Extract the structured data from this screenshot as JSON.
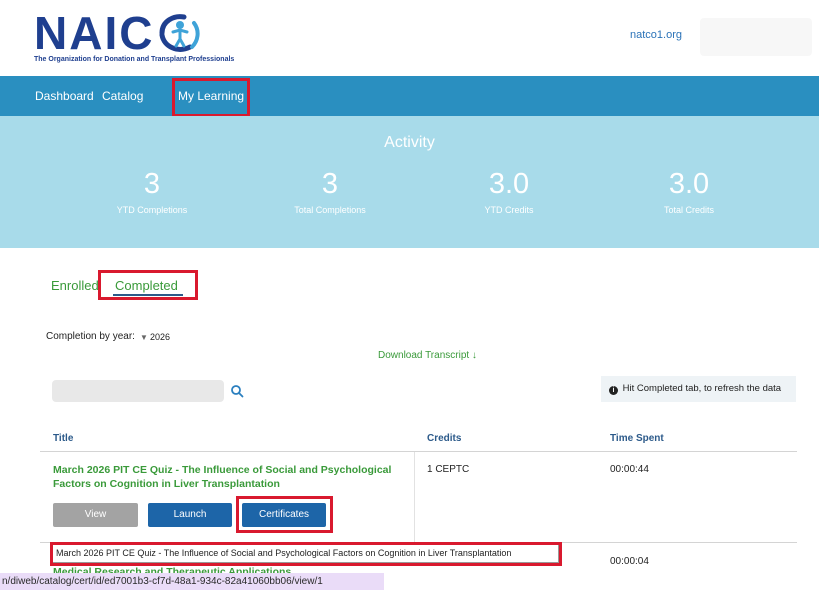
{
  "header": {
    "logo_text": "NAIC",
    "logo_tagline": "The Organization for Donation and Transplant Professionals",
    "site_link": "natco1.org"
  },
  "nav": {
    "items": [
      {
        "label": "Dashboard"
      },
      {
        "label": "Catalog"
      },
      {
        "label": "My Learning"
      }
    ]
  },
  "activity": {
    "title": "Activity",
    "stats": [
      {
        "value": "3",
        "label": "YTD Completions"
      },
      {
        "value": "3",
        "label": "Total Completions"
      },
      {
        "value": "3.0",
        "label": "YTD Credits"
      },
      {
        "value": "3.0",
        "label": "Total Credits"
      }
    ]
  },
  "tabs": {
    "enrolled": "Enrolled",
    "completed": "Completed"
  },
  "filters": {
    "year_label": "Completion by year:",
    "year_value": "2026",
    "download_label": "Download Transcript ↓",
    "search_placeholder": "",
    "hint": "Hit Completed tab, to refresh the data"
  },
  "table": {
    "headers": [
      "Title",
      "Credits",
      "Time Spent"
    ],
    "rows": [
      {
        "title": "March 2026 PIT CE Quiz - The Influence of Social and Psychological Factors on Cognition in Liver Transplantation",
        "credits": "1 CEPTC",
        "time": "00:00:44",
        "buttons": {
          "view": "View",
          "launch": "Launch",
          "certificates": "Certificates"
        }
      },
      {
        "title": "Medical Research and Therapeutic Applications",
        "credits": "",
        "time": "00:00:04"
      }
    ]
  },
  "tooltip": "March 2026 PIT CE Quiz - The Influence of Social and Psychological Factors on Cognition in Liver Transplantation",
  "status_url": "n/diweb/catalog/cert/id/ed7001b3-cf7d-48a1-934c-82a41060bb06/view/1",
  "colors": {
    "nav_bg": "#2a8fc0",
    "activity_bg": "#a8dbea",
    "accent_green": "#3a9a3a",
    "button_blue": "#1d65a8",
    "highlight_red": "#d9192e"
  }
}
